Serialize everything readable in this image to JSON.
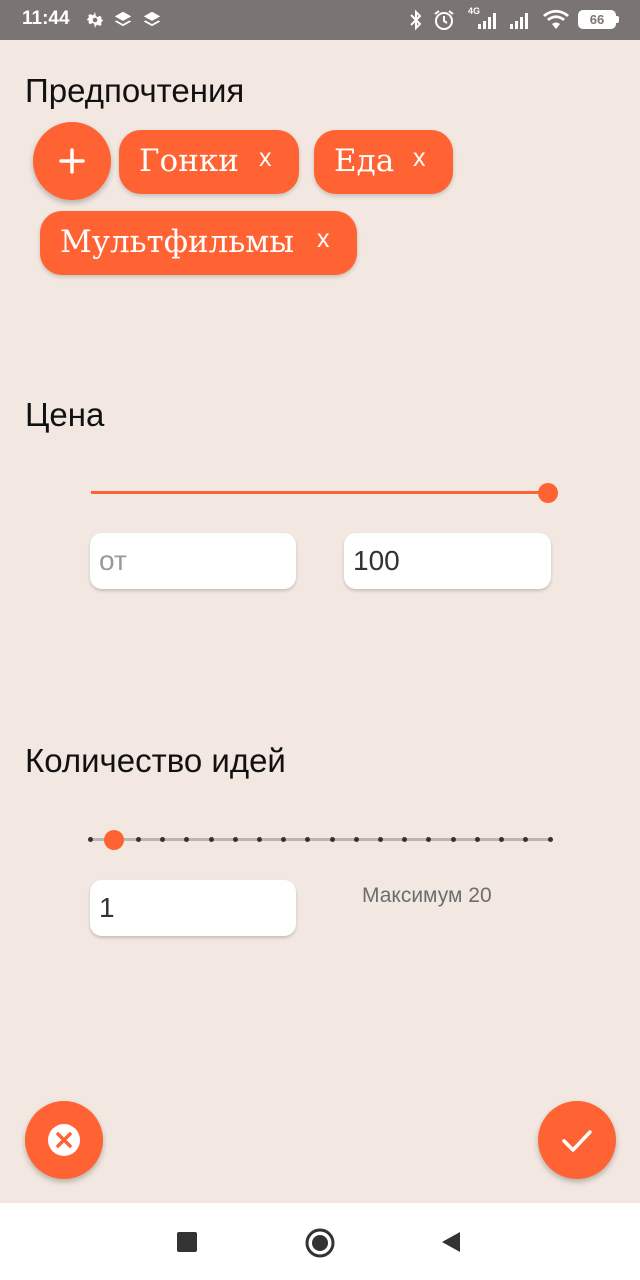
{
  "status_bar": {
    "time": "11:44",
    "network": "4G",
    "battery": "66",
    "icons": [
      "gear-icon",
      "layers-icon",
      "layers-icon",
      "bluetooth-icon",
      "alarm-icon",
      "signal-icon",
      "signal-icon",
      "wifi-icon",
      "battery-icon"
    ]
  },
  "preferences": {
    "title": "Предпочтения",
    "add_icon": "plus-icon",
    "chips": [
      {
        "label": "Гонки",
        "remove": "x"
      },
      {
        "label": "Еда",
        "remove": "x"
      },
      {
        "label": "Мультфильмы",
        "remove": "x"
      }
    ]
  },
  "price": {
    "title": "Цена",
    "from_placeholder": "от",
    "from_value": "",
    "to_value": "100",
    "slider_fraction": 1.0
  },
  "ideas": {
    "title": "Количество идей",
    "value": "1",
    "max_label": "Максимум 20",
    "slider_step": 1,
    "slider_steps_total": 20
  },
  "actions": {
    "cancel_icon": "cancel-icon",
    "confirm_icon": "check-icon"
  },
  "navbar": {
    "icons": [
      "square-icon",
      "circle-icon",
      "back-triangle-icon"
    ]
  },
  "colors": {
    "accent": "#FF6333",
    "background": "#F2E8E1",
    "status_bar": "#7A7572"
  }
}
